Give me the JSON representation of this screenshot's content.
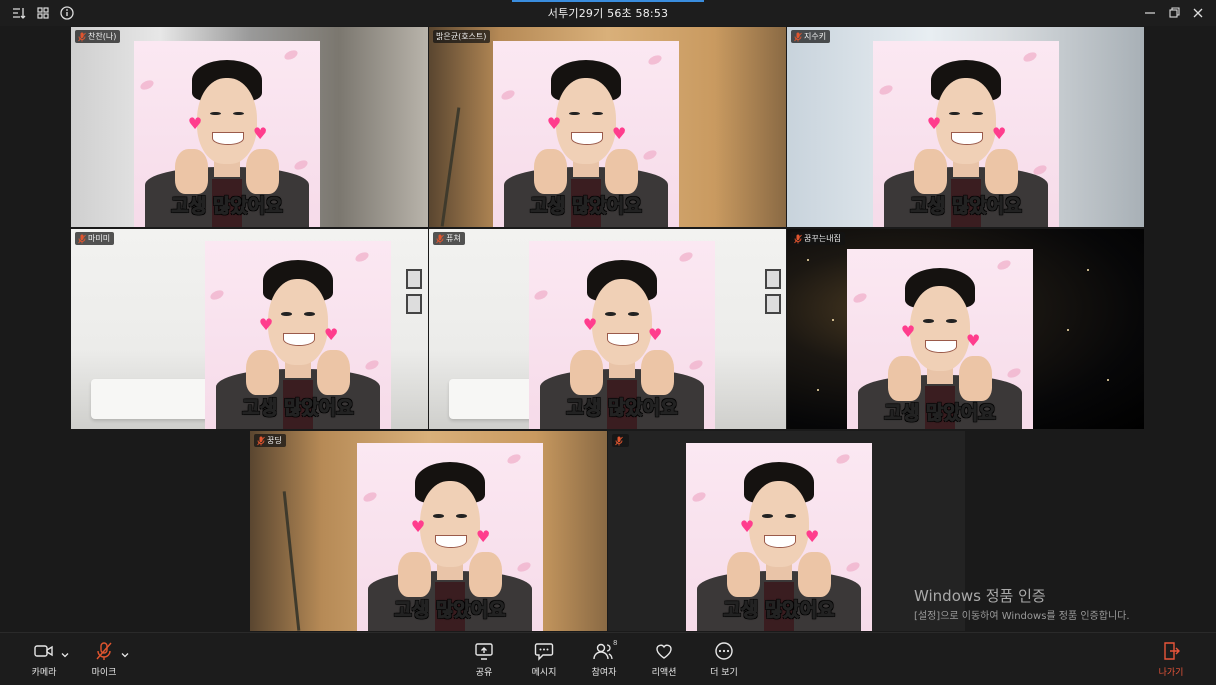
{
  "window": {
    "title": "서투기29기 56초 58:53",
    "controls": [
      "minimize-icon",
      "restore-icon",
      "close-icon"
    ],
    "left_icons": [
      "sort-icon",
      "grid-icon",
      "info-icon"
    ]
  },
  "tiles": [
    {
      "name": "찬찬(나)",
      "caption": "고생 많았어요",
      "background": "room"
    },
    {
      "name": "밝은균(호스트)",
      "caption": "고생 많았어요",
      "background": "warm-wall"
    },
    {
      "name": "지수키",
      "caption": "고생 많았어요",
      "background": "room"
    },
    {
      "name": "마미미",
      "caption": "고생 많았어요",
      "background": "living-room"
    },
    {
      "name": "퓨쳐",
      "caption": "고생 많았어요",
      "background": "living-room"
    },
    {
      "name": "꿈꾸는내집",
      "caption": "고생 많았어요",
      "background": "space"
    },
    {
      "name": "꿍딩",
      "caption": "고생 많았어요",
      "background": "warm-wall"
    },
    {
      "name": "",
      "caption": "고생 많았어요",
      "background": "dark"
    }
  ],
  "watermark": {
    "title": "Windows 정품 인증",
    "subtitle": "[설정]으로 이동하여 Windows를 정품 인증합니다."
  },
  "toolbar": {
    "camera_label": "카메라",
    "mic_label": "마이크",
    "share_label": "공유",
    "message_label": "메시지",
    "participants_label": "참여자",
    "participants_count": "8",
    "reaction_label": "리액션",
    "more_label": "더 보기",
    "leave_label": "나가기"
  },
  "colors": {
    "accent": "#3a8dde",
    "leave": "#e8553a",
    "muted_mic": "#e0552f"
  }
}
